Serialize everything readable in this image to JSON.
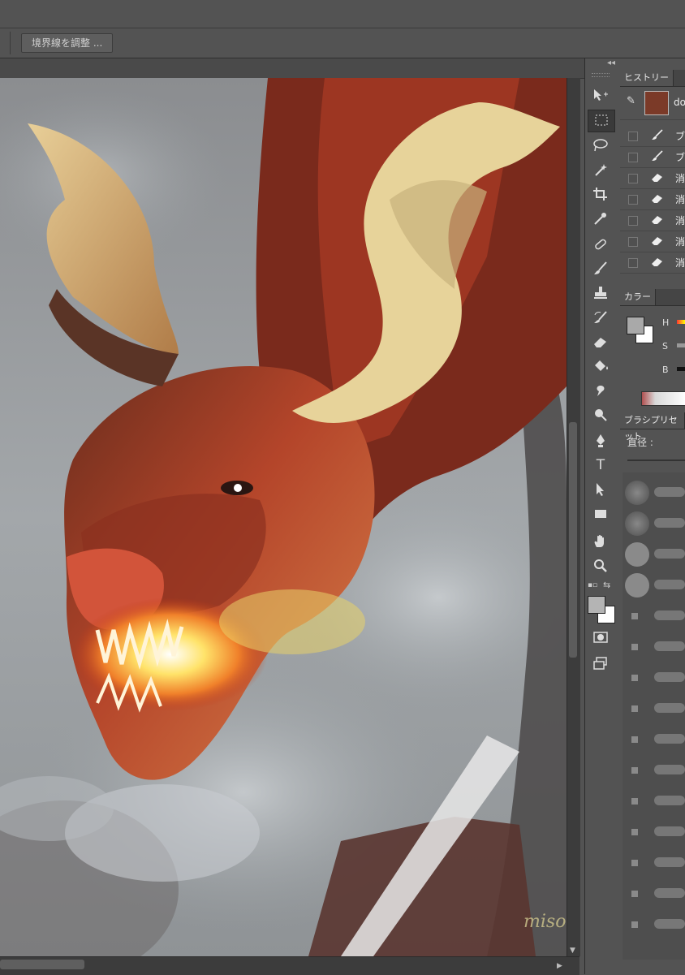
{
  "options_bar": {
    "refine_edge_label": "境界線を調整 ..."
  },
  "panels": {
    "history": {
      "tab_label": "ヒストリー",
      "snapshot_label": "do",
      "states": [
        {
          "icon": "brush-icon",
          "label": "ブ"
        },
        {
          "icon": "brush-icon",
          "label": "ブ"
        },
        {
          "icon": "eraser-icon",
          "label": "消"
        },
        {
          "icon": "eraser-icon",
          "label": "消"
        },
        {
          "icon": "eraser-icon",
          "label": "消"
        },
        {
          "icon": "eraser-icon",
          "label": "消"
        },
        {
          "icon": "eraser-icon",
          "label": "消"
        }
      ]
    },
    "color": {
      "tab_label": "カラー",
      "channels": [
        "H",
        "S",
        "B"
      ],
      "foreground": "#a9a9a9",
      "background": "#ffffff"
    },
    "brush_preset": {
      "tab_label": "ブラシプリセット",
      "size_label": "直径 :"
    }
  },
  "toolbar": {
    "tools": [
      "move-icon",
      "marquee-icon",
      "lasso-icon",
      "magic-wand-icon",
      "crop-icon",
      "eyedropper-icon",
      "healing-icon",
      "brush-icon",
      "stamp-icon",
      "history-brush-icon",
      "eraser-icon",
      "paint-bucket-icon",
      "smudge-icon",
      "dodge-icon",
      "pen-icon",
      "type-icon",
      "path-select-icon",
      "rectangle-icon",
      "hand-icon",
      "zoom-icon"
    ],
    "type_glyph": "T",
    "foreground_color": "#b4b4b4",
    "background_color": "#ffffff"
  },
  "canvas": {
    "signature": "misokicko"
  }
}
